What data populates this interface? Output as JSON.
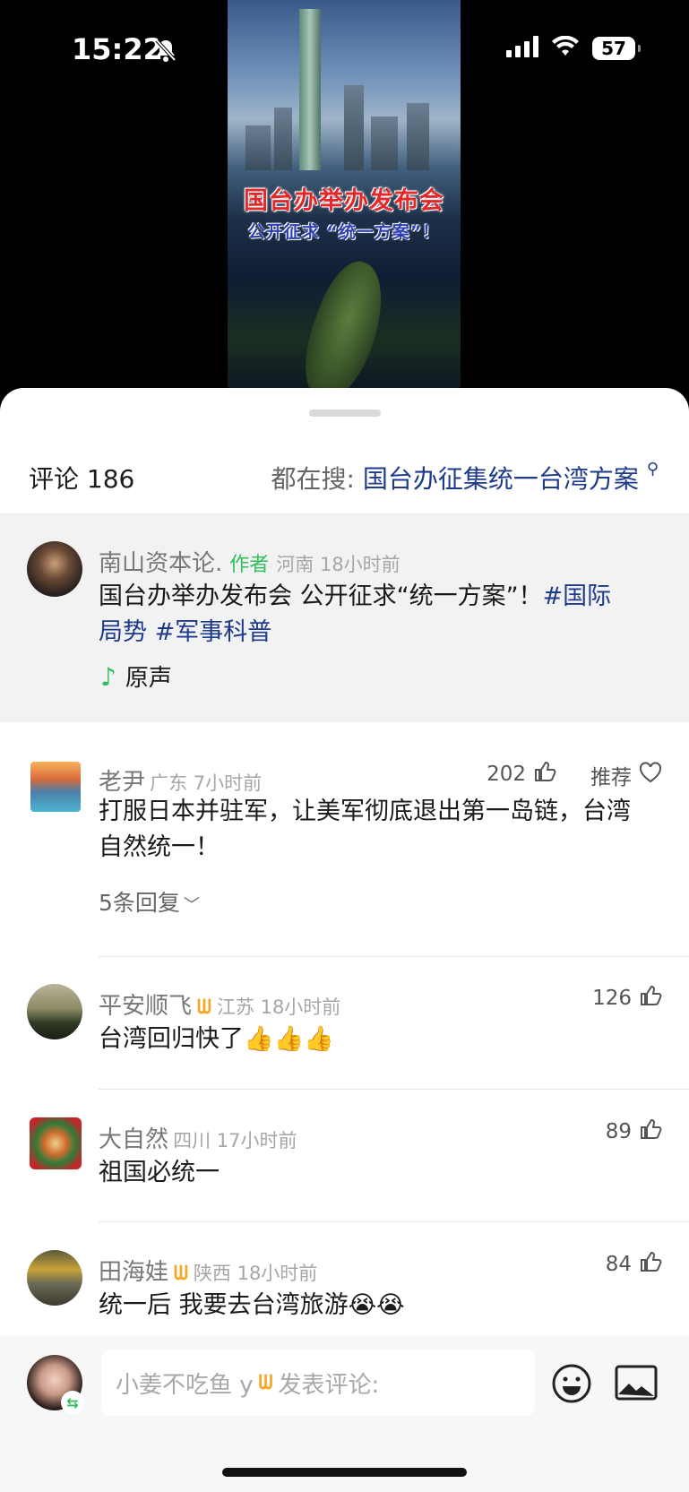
{
  "status": {
    "time": "15:22",
    "battery": "57"
  },
  "video": {
    "title": "国台办举办发布会",
    "subtitle": "公开征求 “统一方案”！"
  },
  "header": {
    "count_label": "评论 186",
    "search_prefix": "都在搜:",
    "search_keyword": "国台办征集统一台湾方案"
  },
  "author_post": {
    "name": "南山资本论.",
    "author_tag": "作者",
    "location_time": "河南 18小时前",
    "text": "国台办举办发布会  公开征求“统一方案”！",
    "tag1": "#国际",
    "tag2": "局势",
    "tag3": "#军事科普",
    "sound_label": "原声"
  },
  "comments": [
    {
      "name": "老尹",
      "meta": "广东 7小时前",
      "likes": "202",
      "recommend": "推荐",
      "text": "打服日本并驻军，让美军彻底退出第一岛链，台湾自然统一！",
      "replies": "5条回复"
    },
    {
      "name": "平安顺飞",
      "meta": "江苏 18小时前",
      "likes": "126",
      "text": "台湾回归快了👍👍👍"
    },
    {
      "name": "大自然",
      "meta": "四川 17小时前",
      "likes": "89",
      "text": "祖国必统一"
    },
    {
      "name": "田海娃",
      "meta": "陕西 18小时前",
      "likes": "84",
      "text": "统一后   我要去台湾旅游😭😭"
    }
  ],
  "input": {
    "placeholder_user": "小姜不吃鱼 y",
    "placeholder_action": "发表评论:"
  },
  "colors": {
    "accent_blue": "#1e3a8a",
    "author_green": "#2fbf5b",
    "crown_gold": "#f5a623"
  }
}
